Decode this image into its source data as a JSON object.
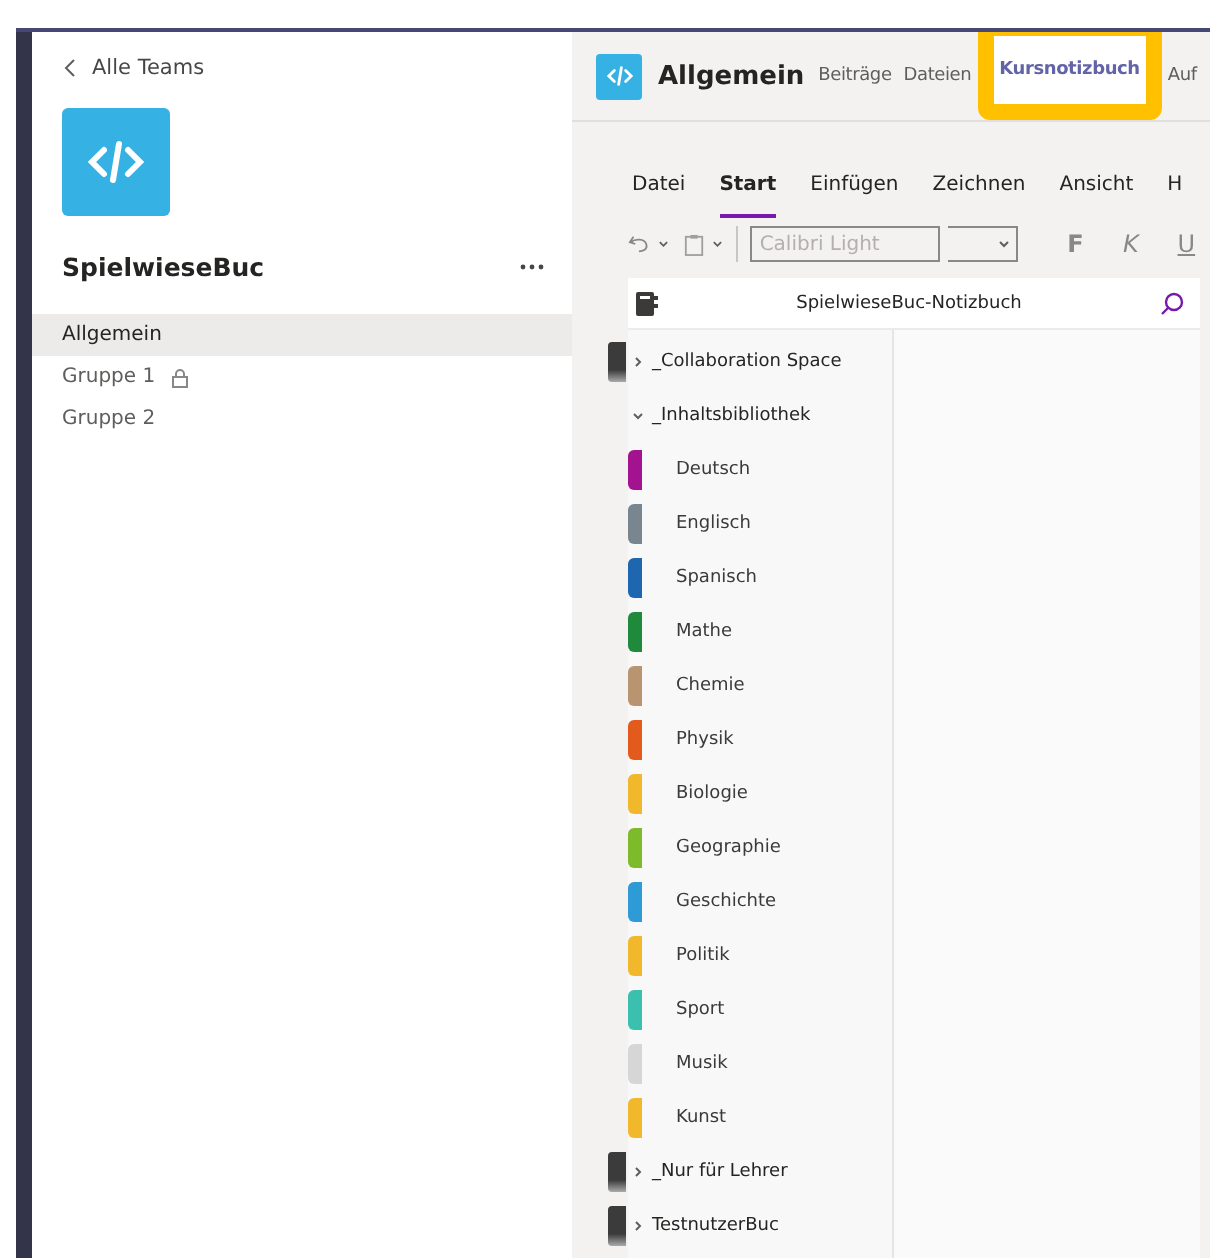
{
  "sidebar": {
    "back_link": "Alle Teams",
    "team_name": "SpielwieseBuc",
    "channels": [
      {
        "label": "Allgemein",
        "selected": true,
        "locked": false
      },
      {
        "label": "Gruppe 1",
        "selected": false,
        "locked": true
      },
      {
        "label": "Gruppe 2",
        "selected": false,
        "locked": false
      }
    ]
  },
  "header": {
    "channel_title": "Allgemein",
    "tabs": [
      {
        "label": "Beiträge",
        "selected": false,
        "highlighted": false
      },
      {
        "label": "Dateien",
        "selected": false,
        "highlighted": false
      },
      {
        "label": "Kursnotizbuch",
        "selected": true,
        "highlighted": true
      },
      {
        "label": "Auf",
        "selected": false,
        "highlighted": false
      }
    ]
  },
  "ribbon": {
    "tabs": [
      {
        "label": "Datei",
        "selected": false
      },
      {
        "label": "Start",
        "selected": true
      },
      {
        "label": "Einfügen",
        "selected": false
      },
      {
        "label": "Zeichnen",
        "selected": false
      },
      {
        "label": "Ansicht",
        "selected": false
      },
      {
        "label": "H",
        "selected": false
      }
    ],
    "font_placeholder": "Calibri Light",
    "format_buttons": [
      "F",
      "K",
      "U"
    ]
  },
  "notebook": {
    "title": "SpielwieseBuc-Notizbuch",
    "groups": [
      {
        "label": "_Collaboration Space",
        "expanded": false
      },
      {
        "label": "_Inhaltsbibliothek",
        "expanded": true,
        "children": [
          {
            "label": "Deutsch",
            "color": "#a4138f"
          },
          {
            "label": "Englisch",
            "color": "#7a868f"
          },
          {
            "label": "Spanisch",
            "color": "#1e67b0"
          },
          {
            "label": "Mathe",
            "color": "#1f8a3c"
          },
          {
            "label": "Chemie",
            "color": "#b99470"
          },
          {
            "label": "Physik",
            "color": "#e25a1c"
          },
          {
            "label": "Biologie",
            "color": "#f2b82c"
          },
          {
            "label": "Geographie",
            "color": "#7dbb2a"
          },
          {
            "label": "Geschichte",
            "color": "#2f9bd6"
          },
          {
            "label": "Politik",
            "color": "#f2b82c"
          },
          {
            "label": "Sport",
            "color": "#3bbfae"
          },
          {
            "label": "Musik",
            "color": "#d6d6d6"
          },
          {
            "label": "Kunst",
            "color": "#f2b82c"
          }
        ]
      },
      {
        "label": "_Nur für Lehrer",
        "expanded": false
      },
      {
        "label": "TestnutzerBuc",
        "expanded": false
      }
    ]
  }
}
